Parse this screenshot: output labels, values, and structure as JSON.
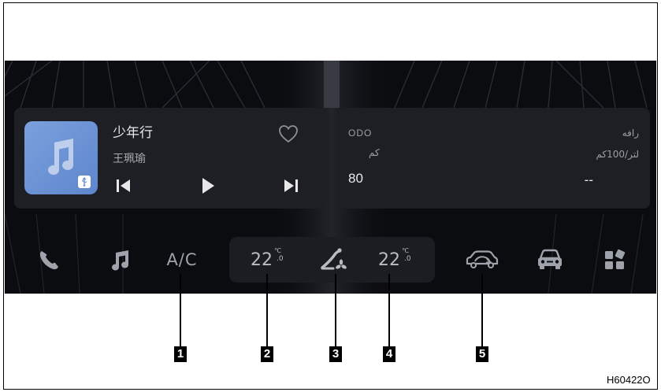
{
  "colors": {
    "screen_bg": "#0b0c10",
    "card_bg": "#1d1f25",
    "album_blue": "#6b90d6",
    "icon_gray": "#9ea3ab",
    "text_primary": "#e8e8ea",
    "callout_black": "#000000"
  },
  "music": {
    "title": "少年行",
    "artist": "王珮瑜",
    "album_icon": "music-note-icon",
    "source_badge_icon": "usb-icon",
    "favorite_icon": "heart-icon",
    "controls": [
      "skip-previous-icon",
      "play-icon",
      "skip-next-icon"
    ]
  },
  "trip": {
    "odo_label": "ODO",
    "odo_unit": "كم",
    "odo_value": "80",
    "fuel_label": "رافه",
    "fuel_unit": "لتر/100كم",
    "fuel_value": "--"
  },
  "dock": {
    "phone_icon": "phone-icon",
    "music_icon": "music-note-icon",
    "ac_label": "A/C",
    "left_temp": "22",
    "left_temp_unit": "℃",
    "left_temp_decimal": ".0",
    "airflow_icon": "airflow-fan-icon",
    "right_temp": "22",
    "right_temp_unit": "℃",
    "right_temp_decimal": ".0",
    "recirculation_icon": "car-recirculation-icon",
    "vehicle_icon": "car-front-icon",
    "apps_icon": "apps-grid-icon"
  },
  "callouts": [
    "1",
    "2",
    "3",
    "4",
    "5"
  ],
  "figure_code": "H60422O"
}
